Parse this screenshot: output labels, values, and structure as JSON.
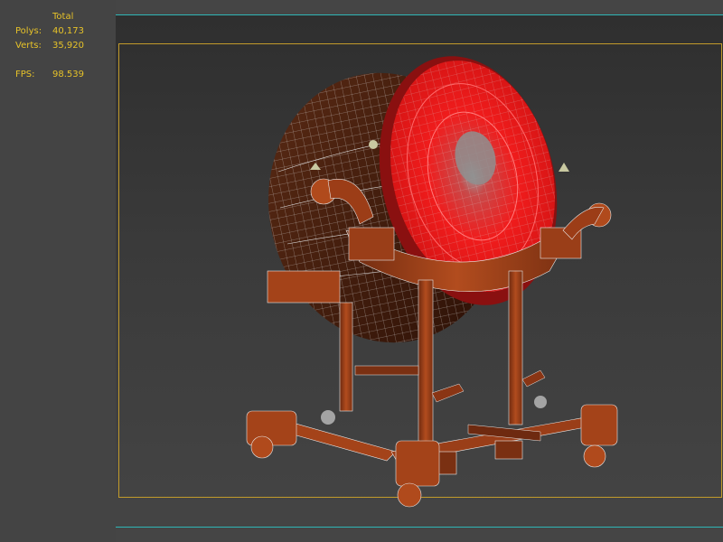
{
  "stats": {
    "column_header": "Total",
    "polys_label": "Polys:",
    "polys_value": "40,173",
    "verts_label": "Verts:",
    "verts_value": "35,920",
    "fps_label": "FPS:",
    "fps_value": "98.539"
  },
  "colors": {
    "stat_text": "#e6c229",
    "panel_bg": "#444444",
    "viewport_border": "#2fb6b6",
    "safe_frame": "#c29b2b",
    "drum_head": "#e81e1e",
    "wood": "#a8431c"
  },
  "viewport": {
    "model_icon": "drum-stand-3d-model"
  }
}
